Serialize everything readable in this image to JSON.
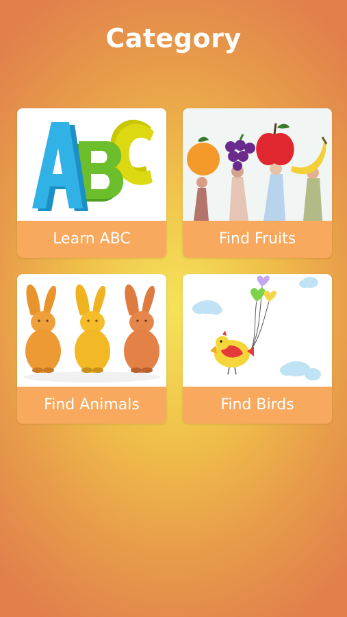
{
  "header": {
    "title": "Category"
  },
  "categories": [
    {
      "label": "Learn ABC",
      "icon": "abc-blocks-icon"
    },
    {
      "label": "Find Fruits",
      "icon": "fruits-icon"
    },
    {
      "label": "Find Animals",
      "icon": "rabbits-icon"
    },
    {
      "label": "Find Birds",
      "icon": "bird-balloons-icon"
    }
  ],
  "colors": {
    "background_center": "#f5e35a",
    "background_edge": "#e07f4c",
    "label_background": "#f8a95e",
    "label_text": "#ffffff"
  }
}
